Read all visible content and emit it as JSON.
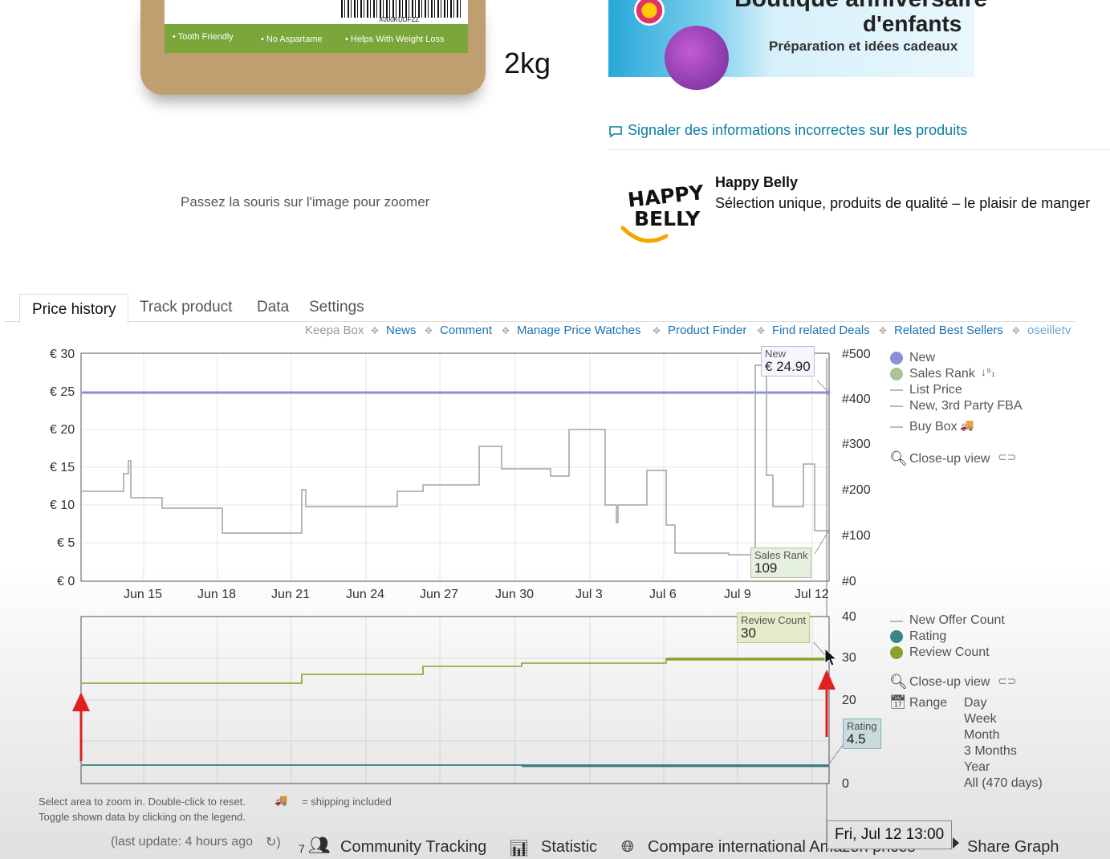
{
  "product": {
    "bag_features": [
      "• Tooth Friendly",
      "• No Aspartame",
      "• Helps With Weight Loss"
    ],
    "barcode_text": "X000KUDFZZ",
    "weight": "2kg",
    "zoom_hint": "Passez la souris sur l'image pour zoomer"
  },
  "banner": {
    "line1": "Boutique anniversaire",
    "line2": "d'enfants",
    "line3": "Préparation et idées cadeaux"
  },
  "report_link": "Signaler des informations incorrectes sur les produits",
  "brand": {
    "logo_text_1": "HAPPY",
    "logo_text_2": "BELLY",
    "name": "Happy Belly",
    "tagline": "Sélection unique, produits de qualité – le plaisir de manger"
  },
  "keepa": {
    "tabs": [
      "Price history",
      "Track product",
      "Data",
      "Settings"
    ],
    "links": [
      "Keepa Box",
      "News",
      "Comment",
      "Manage Price Watches",
      "Product Finder",
      "Find related Deals",
      "Related Best Sellers",
      "oseilletv"
    ],
    "price_axis": [
      "€ 30",
      "€ 25",
      "€ 20",
      "€ 15",
      "€ 10",
      "€ 5",
      "€ 0"
    ],
    "rank_axis": [
      "#500",
      "#400",
      "#300",
      "#200",
      "#100",
      "#0"
    ],
    "x_labels": [
      "Jun 15",
      "Jun 18",
      "Jun 21",
      "Jun 24",
      "Jun 27",
      "Jun 30",
      "Jul 3",
      "Jul 6",
      "Jul 9",
      "Jul 12"
    ],
    "legend_top": [
      "New",
      "Sales Rank",
      "List Price",
      "New, 3rd Party FBA",
      "Buy Box"
    ],
    "closeup": "Close-up view",
    "tip_new": {
      "label": "New",
      "value": "€ 24.90"
    },
    "tip_rank": {
      "label": "Sales Rank",
      "value": "109"
    },
    "lower_axis": [
      "40",
      "30",
      "20",
      "0"
    ],
    "legend_bottom": [
      "New Offer Count",
      "Rating",
      "Review Count"
    ],
    "range_label": "Range",
    "ranges": [
      "Day",
      "Week",
      "Month",
      "3 Months",
      "Year",
      "All (470 days)"
    ],
    "tip_review": {
      "label": "Review Count",
      "value": "30"
    },
    "tip_rating": {
      "label": "Rating",
      "value": "4.5"
    },
    "hint1": "Select area to zoom in. Double-click to reset.",
    "shipping_note": "= shipping included",
    "hint2": "Toggle shown data by clicking on the legend.",
    "last_update": "(last update: 4 hours ago",
    "bottom_links": {
      "count": "7",
      "community": "Community Tracking",
      "statistic": "Statistic",
      "compare": "Compare international Amazon prices",
      "share": "Share Graph"
    },
    "date_tooltip": "Fri, Jul 12 13:00"
  },
  "colors": {
    "new": "#8d8ddb",
    "sales_rank": "#a9c29a",
    "rating": "#3d8a8a",
    "review": "#8fa82e",
    "link": "#1a73b8"
  }
}
